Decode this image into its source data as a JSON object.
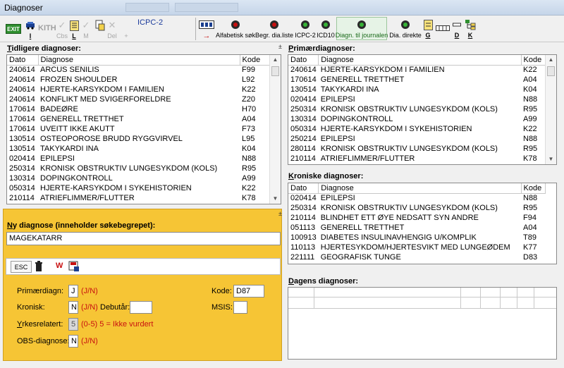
{
  "window": {
    "title": "Diagnoser"
  },
  "toolbar": {
    "exit_label": "EXIT",
    "i_label": "I",
    "kith_label": "KITH",
    "cbs_label": "Cbs",
    "l_label": "L",
    "m_label": "M",
    "del_label": "Del",
    "plus_label": "+",
    "icpc_label": "ICPC-2",
    "alfabetisk_label": "Alfabetisk søk",
    "begr_label": "Begr. dia.liste",
    "icpc2_label": "ICPC-2",
    "icd10_label": "ICD10",
    "diagn_journal_label": "Diagn. til journalen",
    "dia_direkte_label": "Dia. direkte",
    "g_label": "G",
    "d_label": "D",
    "k_label": "K",
    "accent_green": "#2f8f2f"
  },
  "tidligere": {
    "title_first": "T",
    "title_rest": "idligere diagnoser:",
    "columns": [
      "Dato",
      "Diagnose",
      "Kode"
    ],
    "rows": [
      [
        "240614",
        "ARCUS SENILIS",
        "F99"
      ],
      [
        "240614",
        "FROZEN SHOULDER",
        "L92"
      ],
      [
        "240614",
        "HJERTE-KARSYKDOM I FAMILIEN",
        "K22"
      ],
      [
        "240614",
        "KONFLIKT MED SVIGERFORELDRE",
        "Z20"
      ],
      [
        "170614",
        "BADEØRE",
        "H70"
      ],
      [
        "170614",
        "GENERELL TRETTHET",
        "A04"
      ],
      [
        "170614",
        "UVEITT IKKE AKUTT",
        "F73"
      ],
      [
        "130514",
        "OSTEOPOROSE BRUDD RYGGVIRVEL",
        "L95"
      ],
      [
        "130514",
        "TAKYKARDI INA",
        "K04"
      ],
      [
        "020414",
        "EPILEPSI",
        "N88"
      ],
      [
        "250314",
        "KRONISK OBSTRUKTIV LUNGESYKDOM (KOLS)",
        "R95"
      ],
      [
        "130314",
        "DOPINGKONTROLL",
        "A99"
      ],
      [
        "050314",
        "HJERTE-KARSYKDOM I SYKEHISTORIEN",
        "K22"
      ],
      [
        "210114",
        "ATRIEFLIMMER/FLUTTER",
        "K78"
      ]
    ]
  },
  "primaer": {
    "title_first": "P",
    "title_rest": "rimærdiagnoser:",
    "columns": [
      "Dato",
      "Diagnose",
      "Kode"
    ],
    "rows": [
      [
        "240614",
        "HJERTE-KARSYKDOM I FAMILIEN",
        "K22"
      ],
      [
        "170614",
        "GENERELL TRETTHET",
        "A04"
      ],
      [
        "130514",
        "TAKYKARDI INA",
        "K04"
      ],
      [
        "020414",
        "EPILEPSI",
        "N88"
      ],
      [
        "250314",
        "KRONISK OBSTRUKTIV LUNGESYKDOM (KOLS)",
        "R95"
      ],
      [
        "130314",
        "DOPINGKONTROLL",
        "A99"
      ],
      [
        "050314",
        "HJERTE-KARSYKDOM I SYKEHISTORIEN",
        "K22"
      ],
      [
        "250214",
        "EPILEPSI",
        "N88"
      ],
      [
        "280114",
        "KRONISK OBSTRUKTIV LUNGESYKDOM (KOLS)",
        "R95"
      ],
      [
        "210114",
        "ATRIEFLIMMER/FLUTTER",
        "K78"
      ]
    ]
  },
  "kroniske": {
    "title_first": "K",
    "title_rest": "roniske diagnoser:",
    "columns": [
      "Dato",
      "Diagnose",
      "Kode"
    ],
    "rows": [
      [
        "020414",
        "EPILEPSI",
        "N88"
      ],
      [
        "250314",
        "KRONISK OBSTRUKTIV LUNGESYKDOM (KOLS)",
        "R95"
      ],
      [
        "210114",
        "BLINDHET ETT ØYE NEDSATT SYN ANDRE",
        "F94"
      ],
      [
        "051113",
        "GENERELL TRETTHET",
        "A04"
      ],
      [
        "100913",
        "DIABETES INSULINAVHENGIG U/KOMPLIK",
        "T89"
      ],
      [
        "110113",
        "HJERTESYKDOM/HJERTESVIKT MED LUNGEØDEM",
        "K77"
      ],
      [
        "221111",
        "GEOGRAFISK TUNGE",
        "D83"
      ]
    ]
  },
  "dagens": {
    "title_first": "D",
    "title_rest": "agens diagnoser:"
  },
  "ny": {
    "title_first": "N",
    "title_rest": "y diagnose (inneholder søkebegrepet):",
    "search_value": "MAGEKATARR",
    "esc_label": "ESC",
    "primaer_label": "Primærdiagn:",
    "primaer_value": "J",
    "primaer_hint": "(J/N)",
    "kronisk_label": "Kronisk:",
    "kronisk_value": "N",
    "kronisk_hint": "(J/N)",
    "debut_label": "Debutår:",
    "debut_value": "",
    "yrke_label_first": "Y",
    "yrke_label_rest": "rkesrelatert:",
    "yrke_value": "5",
    "yrke_hint": "(0-5)   5 = Ikke vurdert",
    "obs_label": "OBS-diagnose:",
    "obs_value": "N",
    "obs_hint": "(J/N)",
    "kode_label": "Kode:",
    "kode_value": "D87",
    "msis_label": "MSIS:",
    "msis_value": "",
    "panel_color": "#f6c535",
    "hint_color": "#c81010"
  }
}
